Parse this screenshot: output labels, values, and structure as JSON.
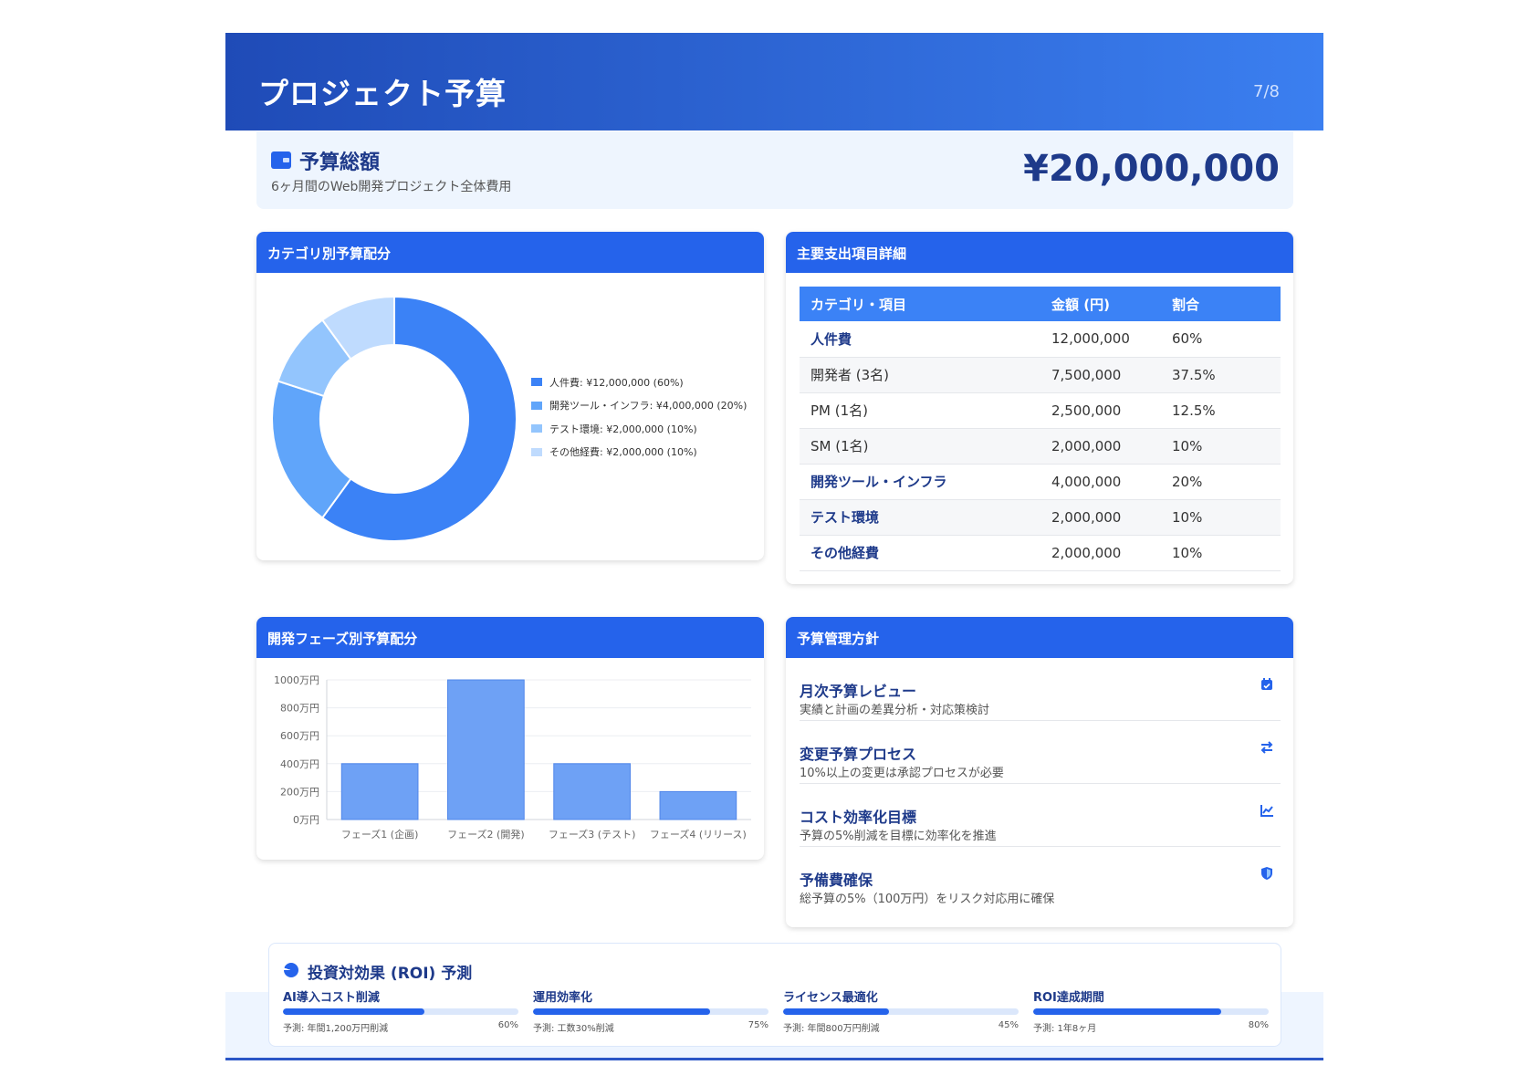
{
  "header": {
    "title": "プロジェクト予算",
    "page": "7/8"
  },
  "total": {
    "icon": "wallet-icon",
    "title": "予算総額",
    "subtitle": "6ヶ月間のWeb開発プロジェクト全体費用",
    "amount": "¥20,000,000"
  },
  "donut_card": {
    "title": "カテゴリ別予算配分"
  },
  "table_card": {
    "title": "主要支出項目詳細",
    "headers": [
      "カテゴリ・項目",
      "金額 (円)",
      "割合"
    ],
    "rows": [
      {
        "item": "人件費",
        "amount": "12,000,000",
        "ratio": "60%"
      },
      {
        "item": "開発者 (3名)",
        "amount": "7,500,000",
        "ratio": "37.5%"
      },
      {
        "item": "PM (1名)",
        "amount": "2,500,000",
        "ratio": "12.5%"
      },
      {
        "item": "SM (1名)",
        "amount": "2,000,000",
        "ratio": "10%"
      },
      {
        "item": "開発ツール・インフラ",
        "amount": "4,000,000",
        "ratio": "20%"
      },
      {
        "item": "テスト環境",
        "amount": "2,000,000",
        "ratio": "10%"
      },
      {
        "item": "その他経費",
        "amount": "2,000,000",
        "ratio": "10%"
      }
    ]
  },
  "bars_card": {
    "title": "開発フェーズ別予算配分"
  },
  "policy_card": {
    "title": "予算管理方針",
    "items": [
      {
        "title": "月次予算レビュー",
        "desc": "実績と計画の差異分析・対応策検討",
        "icon": "calendar-icon"
      },
      {
        "title": "変更予算プロセス",
        "desc": "10%以上の変更は承認プロセスが必要",
        "icon": "exchange-icon"
      },
      {
        "title": "コスト効率化目標",
        "desc": "予算の5%削減を目標に効率化を推進",
        "icon": "line-chart-icon"
      },
      {
        "title": "予備費確保",
        "desc": "総予算の5%（100万円）をリスク対応用に確保",
        "icon": "shield-icon"
      }
    ]
  },
  "roi": {
    "icon": "pie-chart-icon",
    "title": "投資対効果 (ROI) 予測",
    "items": [
      {
        "label": "AI導入コスト削減",
        "note": "予測: 年間1,200万円削減",
        "pct": "60%",
        "progress": 0.6
      },
      {
        "label": "運用効率化",
        "note": "予測: 工数30%削減",
        "pct": "75%",
        "progress": 0.75
      },
      {
        "label": "ライセンス最適化",
        "note": "予測: 年間800万円削減",
        "pct": "45%",
        "progress": 0.45
      },
      {
        "label": "ROI達成期間",
        "note": "予測: 1年8ヶ月",
        "pct": "80%",
        "progress": 0.8
      }
    ]
  },
  "colors": {
    "header_start": "#1f4bb7",
    "header_end": "#3b7ff0",
    "accent": "#2563eb",
    "dark_text": "#1e3a8a"
  },
  "chart_data": [
    {
      "type": "pie",
      "variant": "donut",
      "categories": [
        "人件費",
        "開発ツール・インフラ",
        "テスト環境",
        "その他経費"
      ],
      "values": [
        12000000,
        4000000,
        2000000,
        2000000
      ],
      "legend": [
        "人件費: ¥12,000,000 (60%)",
        "開発ツール・インフラ: ¥4,000,000 (20%)",
        "テスト環境: ¥2,000,000 (10%)",
        "その他経費: ¥2,000,000 (10%)"
      ],
      "colors": [
        "#3b82f6",
        "#60a5fa",
        "#93c5fd",
        "#bfdbfe"
      ],
      "legend_position": "right"
    },
    {
      "type": "bar",
      "categories": [
        "フェーズ1 (企画)",
        "フェーズ2 (開発)",
        "フェーズ3 (テスト)",
        "フェーズ4 (リリース)"
      ],
      "values": [
        400,
        1000,
        400,
        200
      ],
      "ylim": [
        0,
        1000
      ],
      "yticks": [
        0,
        200,
        400,
        600,
        800,
        1000
      ],
      "ytick_labels": [
        "0万円",
        "200万円",
        "400万円",
        "600万円",
        "800万円",
        "1000万円"
      ],
      "grid": true,
      "bar_color": "#6ea1f5"
    }
  ]
}
